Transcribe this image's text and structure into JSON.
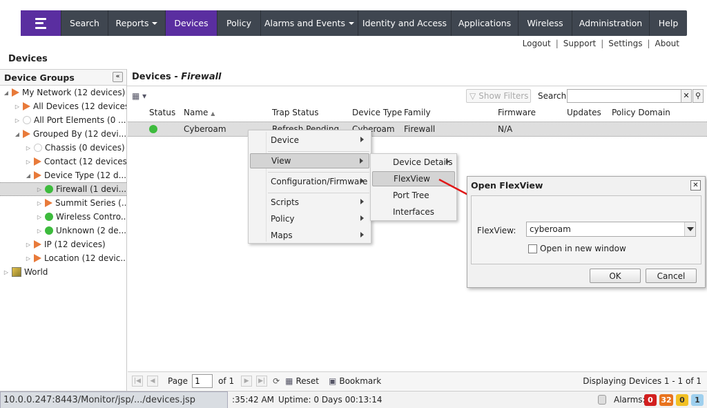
{
  "nav": {
    "items": [
      {
        "label": "Search"
      },
      {
        "label": "Reports"
      },
      {
        "label": "Devices"
      },
      {
        "label": "Policy"
      },
      {
        "label": "Alarms and Events"
      },
      {
        "label": "Identity and Access"
      },
      {
        "label": "Applications"
      },
      {
        "label": "Wireless"
      },
      {
        "label": "Administration"
      },
      {
        "label": "Help"
      }
    ],
    "active": "Devices",
    "colors": {
      "bar": "#3f4650",
      "accent": "#5a2ea0"
    }
  },
  "util_links": [
    "Logout",
    "Support",
    "Settings",
    "About"
  ],
  "page_title": "Devices",
  "left_panel": {
    "title": "Device Groups",
    "collapse_icon": "double-chevron-left-icon",
    "tree": [
      {
        "label": "My Network (12 devices)",
        "level": 0,
        "icon": "tri",
        "expanded": true
      },
      {
        "label": "All Devices (12 devices)",
        "level": 1,
        "icon": "tri",
        "expanded": false
      },
      {
        "label": "All Port Elements (0 ...",
        "level": 1,
        "icon": "empty",
        "expanded": false
      },
      {
        "label": "Grouped By (12 devi...",
        "level": 1,
        "icon": "tri",
        "expanded": true
      },
      {
        "label": "Chassis (0 devices)",
        "level": 2,
        "icon": "empty",
        "expanded": false
      },
      {
        "label": "Contact (12 devices)",
        "level": 2,
        "icon": "tri",
        "expanded": false
      },
      {
        "label": "Device Type (12 d...",
        "level": 2,
        "icon": "tri",
        "expanded": true
      },
      {
        "label": "Firewall (1 devi...",
        "level": 3,
        "icon": "green",
        "expanded": false,
        "selected": true
      },
      {
        "label": "Summit Series (...",
        "level": 3,
        "icon": "tri",
        "expanded": false
      },
      {
        "label": "Wireless Contro...",
        "level": 3,
        "icon": "green",
        "expanded": false
      },
      {
        "label": "Unknown (2 de...",
        "level": 3,
        "icon": "green",
        "expanded": false
      },
      {
        "label": "IP (12 devices)",
        "level": 2,
        "icon": "tri",
        "expanded": false
      },
      {
        "label": "Location (12 devic...",
        "level": 2,
        "icon": "tri",
        "expanded": false
      },
      {
        "label": "World",
        "level": 0,
        "icon": "world",
        "expanded": false
      }
    ]
  },
  "main": {
    "title_prefix": "Devices - ",
    "title_group": "Firewall",
    "show_filters": "Show Filters",
    "search_label": "Search",
    "search_value": "",
    "columns": [
      "Status",
      "Name",
      "Trap Status",
      "Device Type",
      "Family",
      "Firmware",
      "Updates",
      "Policy Domain"
    ],
    "rows": [
      {
        "status": "green",
        "name": "Cyberoam",
        "trap_status": "Refresh Pending",
        "device_type": "Cyberoam",
        "family": "Firewall",
        "firmware": "N/A",
        "updates": "",
        "policy_domain": ""
      }
    ]
  },
  "context_menu": {
    "items": [
      "Device",
      "View",
      "Configuration/Firmware",
      "Scripts",
      "Policy",
      "Maps"
    ],
    "highlighted": "View"
  },
  "view_submenu": {
    "items": [
      "Device Details",
      "FlexView",
      "Port Tree",
      "Interfaces"
    ],
    "highlighted": "FlexView"
  },
  "dialog": {
    "title": "Open FlexView",
    "flexview_label": "FlexView:",
    "flexview_value": "cyberoam",
    "new_window_label": "Open in new window",
    "new_window_checked": false,
    "ok_label": "OK",
    "cancel_label": "Cancel"
  },
  "pager": {
    "page_label": "Page",
    "page_value": "1",
    "of_label": "of 1",
    "reset_label": "Reset",
    "bookmark_label": "Bookmark",
    "display_info": "Displaying Devices 1 - 1 of 1"
  },
  "status_bar": {
    "url": "10.0.0.247:8443/Monitor/jsp/.../devices.jsp",
    "time": ":35:42 AM",
    "uptime": "Uptime: 0 Days 00:13:14",
    "alarms_label": "Alarms:",
    "alarms": [
      {
        "count": "0",
        "color": "#d21f1f"
      },
      {
        "count": "32",
        "color": "#e8731e"
      },
      {
        "count": "0",
        "color": "#f2c024"
      },
      {
        "count": "1",
        "color": "#9fd0ee"
      }
    ]
  }
}
